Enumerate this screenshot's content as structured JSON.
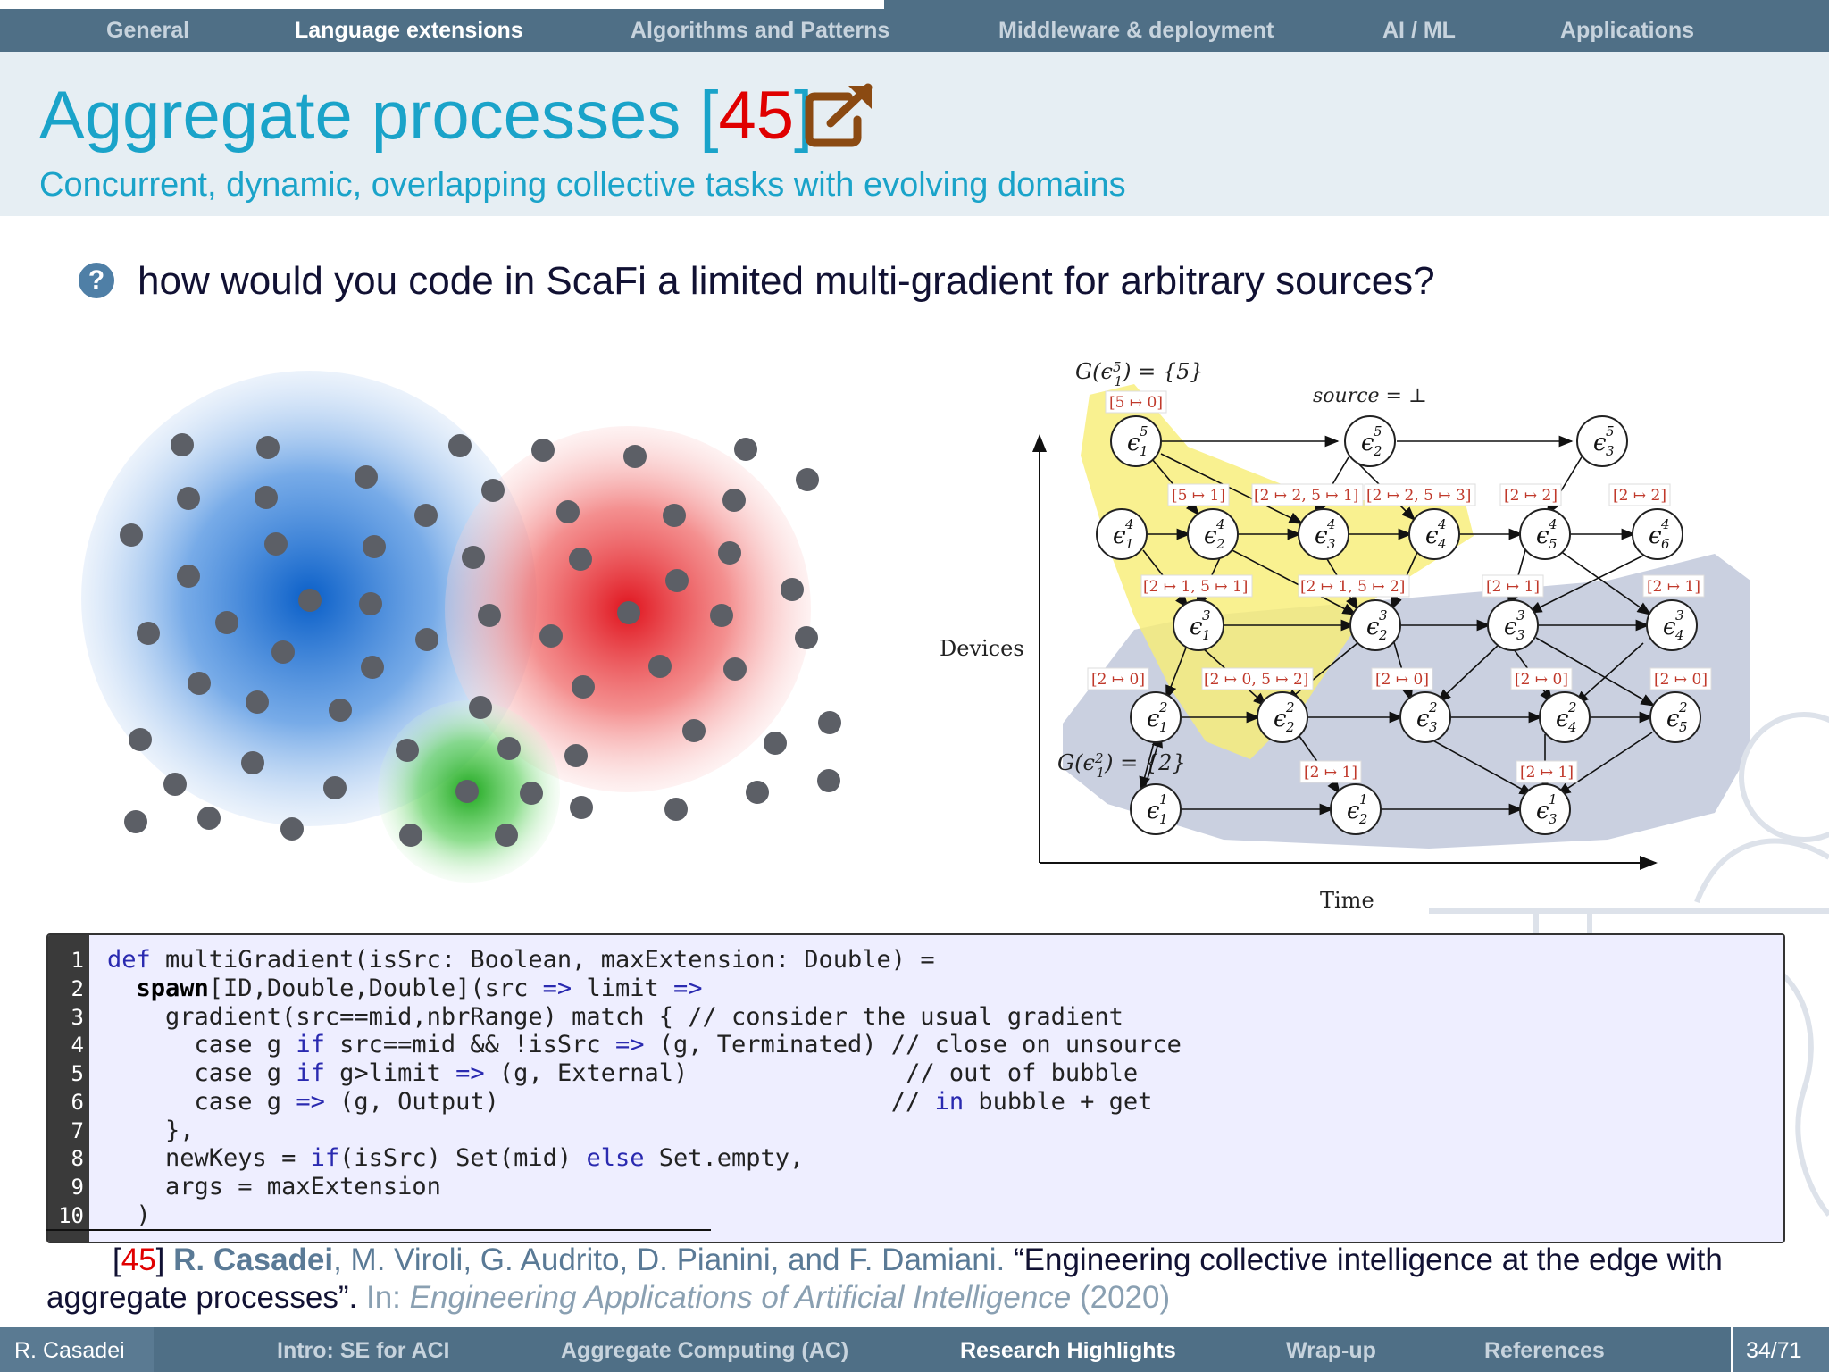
{
  "topnav": {
    "items": [
      "General",
      "Language extensions",
      "Algorithms and Patterns",
      "Middleware & deployment",
      "AI / ML",
      "Applications"
    ],
    "active_index": 1
  },
  "slide": {
    "title": "Aggregate processes",
    "title_cite_open": "[",
    "title_cite_num": "45",
    "title_cite_close": "]",
    "subtitle": "Concurrent, dynamic, overlapping collective tasks with evolving domains",
    "question_icon": "?",
    "question": "how would you code in ScaFi a limited multi-gradient for arbitrary sources?"
  },
  "spacetime": {
    "y_label": "Devices",
    "x_label": "Time",
    "label_g5": "G(ϵ",
    "label_g5_rest": ") = {5}",
    "label_source": "source = ⊥",
    "label_g2": "G(ϵ",
    "label_g2_rest": ") = {2}",
    "tags": [
      "[5 ↦ 0]",
      "[5 ↦ 1]",
      "[2 ↦ 2, 5 ↦ 1]",
      "[2 ↦ 2, 5 ↦ 3]",
      "[2 ↦ 2]",
      "[2 ↦ 2]",
      "[2 ↦ 1, 5 ↦ 1]",
      "[2 ↦ 1, 5 ↦ 2]",
      "[2 ↦ 1]",
      "[2 ↦ 1]",
      "[2 ↦ 0]",
      "[2 ↦ 0, 5 ↦ 2]",
      "[2 ↦ 0]",
      "[2 ↦ 0]",
      "[2 ↦ 0]",
      "[2 ↦ 1]",
      "[2 ↦ 1]"
    ]
  },
  "code": {
    "line_numbers": [
      "1",
      "2",
      "3",
      "4",
      "5",
      "6",
      "7",
      "8",
      "9",
      "10"
    ]
  },
  "reference": {
    "open": "[",
    "num": "45",
    "close": "]",
    "author_bold": "R. Casadei",
    "authors_rest": ", M. Viroli, G. Audrito, D. Pianini, and F. Damiani.",
    "title": " “Engineering collective intelligence at the edge with aggregate processes”.",
    "in": " In: ",
    "venue": "Engineering Applications of Artificial Intelligence",
    "year": " (2020)"
  },
  "bottombar": {
    "author": "R. Casadei",
    "sections": [
      "Intro: SE for ACI",
      "Aggregate Computing (AC)",
      "Research Highlights",
      "Wrap-up",
      "References"
    ],
    "active_index": 2,
    "page": "34/71"
  },
  "colors": {
    "nav_bg": "#4f6f86",
    "title": "#1aa3c9",
    "cite": "#e00000",
    "tag": "#c0392b"
  }
}
